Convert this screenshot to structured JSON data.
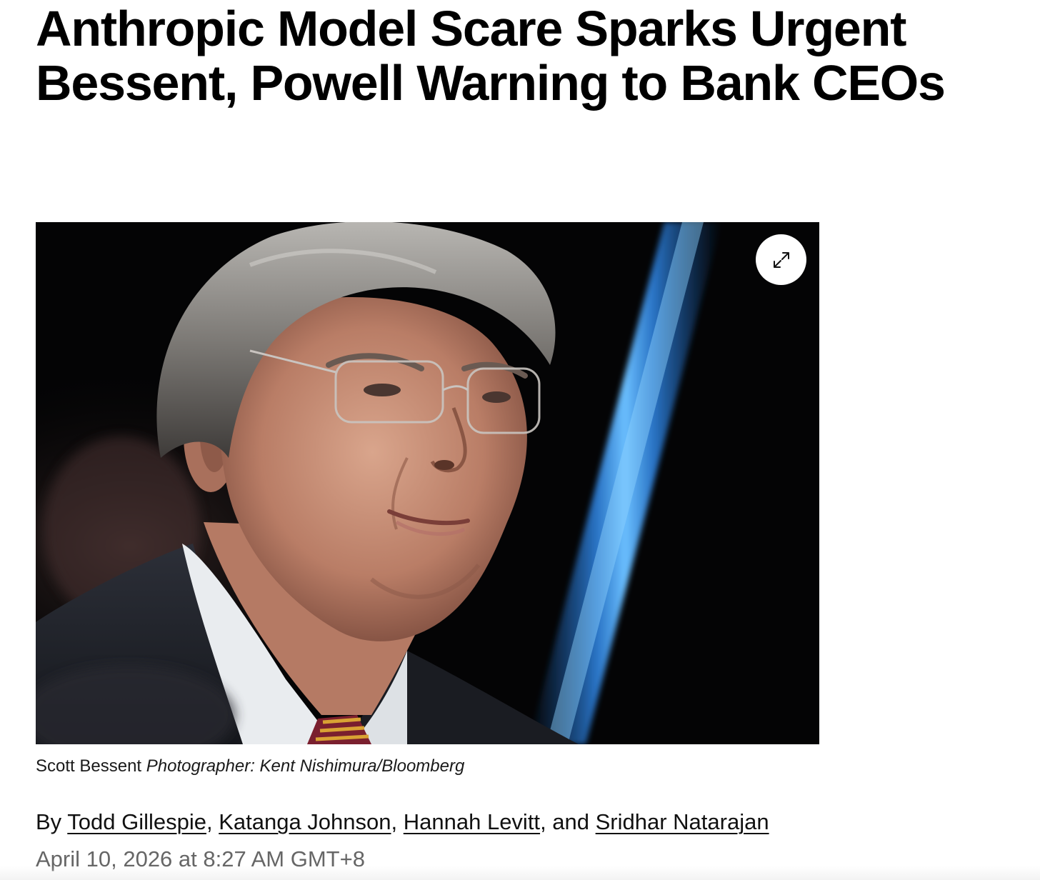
{
  "article": {
    "headline": "Anthropic Model Scare Sparks Urgent Bessent, Powell Warning to Bank CEOs",
    "image": {
      "alt": "Scott Bessent",
      "expand_icon": "expand-arrows-icon"
    },
    "caption": {
      "subject": "Scott Bessent",
      "credit": "Photographer: Kent Nishimura/Bloomberg"
    },
    "byline": {
      "prefix": "By",
      "authors": [
        "Todd Gillespie",
        "Katanga Johnson",
        "Hannah Levitt",
        "Sridhar Natarajan"
      ],
      "sep1": ", ",
      "sep2": ", ",
      "sep3": ", and "
    },
    "timestamp": "April 10, 2026 at 8:27 AM GMT+8"
  },
  "colors": {
    "text": "#000000",
    "meta_text": "#666666",
    "image_background": "#030304",
    "light_streak": "#3a8fe0"
  }
}
